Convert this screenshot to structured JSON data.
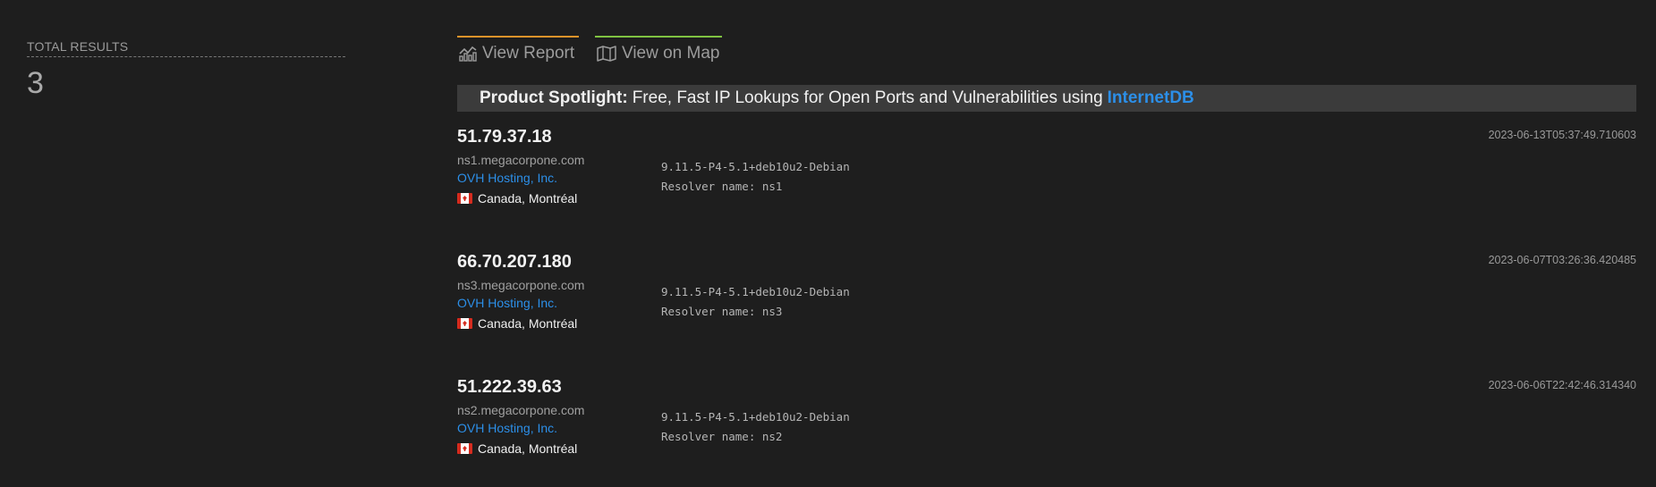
{
  "summary": {
    "label": "TOTAL RESULTS",
    "value": "3"
  },
  "tabs": {
    "report_label": "View Report",
    "map_label": "View on Map",
    "report_color": "#e0932a",
    "map_color": "#80c341"
  },
  "spotlight": {
    "label": "Product Spotlight:",
    "text": "Free, Fast IP Lookups for Open Ports and Vulnerabilities using",
    "link": "InternetDB"
  },
  "results": [
    {
      "ip": "51.79.37.18",
      "hostname": "ns1.megacorpone.com",
      "org": "OVH Hosting, Inc.",
      "country": "Canada",
      "city": "Montréal",
      "banner_line1": "9.11.5-P4-5.1+deb10u2-Debian",
      "banner_line2": "Resolver name: ns1",
      "timestamp": "2023-06-13T05:37:49.710603"
    },
    {
      "ip": "66.70.207.180",
      "hostname": "ns3.megacorpone.com",
      "org": "OVH Hosting, Inc.",
      "country": "Canada",
      "city": "Montréal",
      "banner_line1": "9.11.5-P4-5.1+deb10u2-Debian",
      "banner_line2": "Resolver name: ns3",
      "timestamp": "2023-06-07T03:26:36.420485"
    },
    {
      "ip": "51.222.39.63",
      "hostname": "ns2.megacorpone.com",
      "org": "OVH Hosting, Inc.",
      "country": "Canada",
      "city": "Montréal",
      "banner_line1": "9.11.5-P4-5.1+deb10u2-Debian",
      "banner_line2": "Resolver name: ns2",
      "timestamp": "2023-06-06T22:42:46.314340"
    }
  ],
  "location_separator": ","
}
